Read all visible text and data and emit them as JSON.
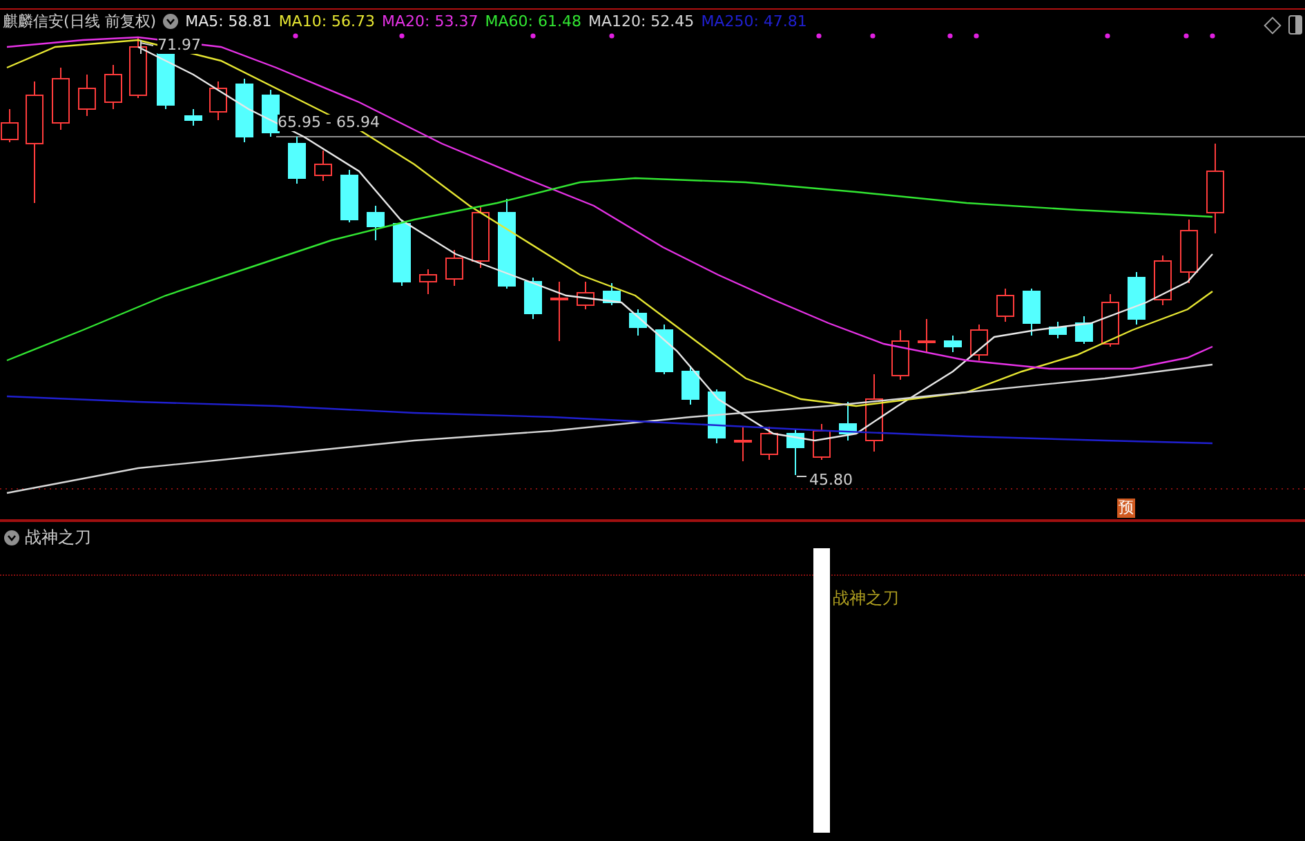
{
  "title": "麒麟信安(日线 前复权)",
  "moving_averages": [
    {
      "label": "MA5: 58.81",
      "color": "#e8e8e8"
    },
    {
      "label": "MA10: 56.73",
      "color": "#e6e632"
    },
    {
      "label": "MA20: 53.37",
      "color": "#e632e6"
    },
    {
      "label": "MA60: 61.48",
      "color": "#32e632"
    },
    {
      "label": "MA120: 52.45",
      "color": "#d8d8d8"
    },
    {
      "label": "MA250: 47.81",
      "color": "#2020d0"
    }
  ],
  "price_labels": {
    "high": "71.97",
    "low": "45.80",
    "level_line": "65.95 - 65.94"
  },
  "forecast_badge": "预",
  "indicator": {
    "title": "战神之刀",
    "bar_label": "战神之刀"
  }
}
